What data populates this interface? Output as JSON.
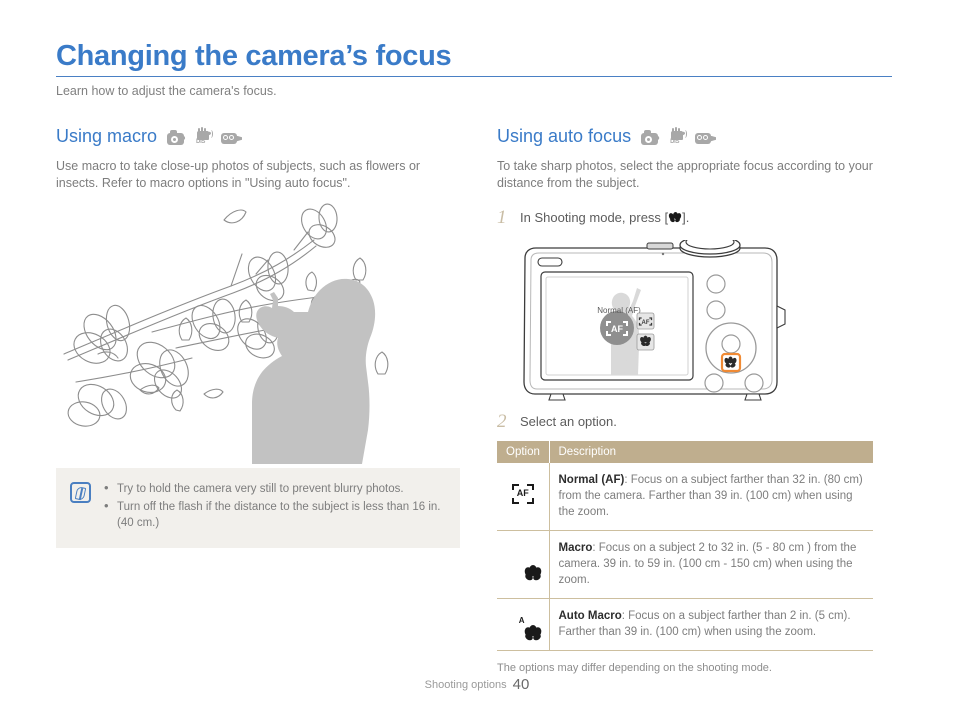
{
  "title": "Changing the camera’s focus",
  "subtitle": "Learn how to adjust the camera's focus.",
  "mode_icons": [
    "camera-program-icon",
    "dis-hand-icon",
    "camcorder-icon"
  ],
  "left": {
    "heading": "Using macro",
    "body": "Use macro to take close-up photos of subjects, such as flowers or insects. Refer to macro options in \"Using auto focus\".",
    "illustration": "magnolia-branch-photographer-illustration",
    "note": {
      "icon": "note-pencil-icon",
      "bullets": [
        "Try to hold the camera very still to prevent blurry photos.",
        "Turn off the flash if the distance to the subject is less than 16 in. (40 cm.)"
      ]
    }
  },
  "right": {
    "heading": "Using auto focus",
    "body": "To take sharp photos, select the appropriate focus according to your distance from the subject.",
    "steps": [
      {
        "num": "1",
        "text_before": "In Shooting mode, press [",
        "inline_icon": "macro-flower-icon",
        "text_after": "]."
      },
      {
        "num": "2",
        "text_before": "Select an option.",
        "inline_icon": "",
        "text_after": ""
      }
    ],
    "camera": {
      "lcd_label": "Normal (AF)",
      "lcd_center_icon": "af-bracket-icon",
      "lcd_option_icons": [
        "af-bracket-icon",
        "macro-flower-icon"
      ],
      "highlighted_button": "macro-button",
      "highlight_color": "#f08a34"
    },
    "table": {
      "headers": [
        "Option",
        "Description"
      ],
      "header_bg": "#bfae8e",
      "rows": [
        {
          "icon": "af-bracket-icon",
          "name": "Normal (AF)",
          "description": ": Focus on a subject farther than 32 in. (80 cm) from the camera. Farther than 39 in. (100 cm) when using the zoom."
        },
        {
          "icon": "macro-flower-icon",
          "name": "Macro",
          "description": ": Focus on a subject 2 to 32 in. (5 - 80 cm ) from the camera. 39 in. to 59 in. (100 cm - 150 cm) when using the zoom."
        },
        {
          "icon": "auto-macro-flower-icon",
          "name": "Auto Macro",
          "description": ": Focus on a subject farther than 2 in. (5 cm). Farther than 39 in. (100 cm) when using the zoom."
        }
      ],
      "footnote": "The options may differ depending on the shooting mode."
    }
  },
  "footer": {
    "label": "Shooting options",
    "page": "40"
  },
  "colors": {
    "title_blue": "#3a7bc8",
    "table_header": "#bfae8e",
    "note_bg": "#f2f0ec",
    "step_number": "#c9bda5",
    "highlight_orange": "#f08a34"
  }
}
